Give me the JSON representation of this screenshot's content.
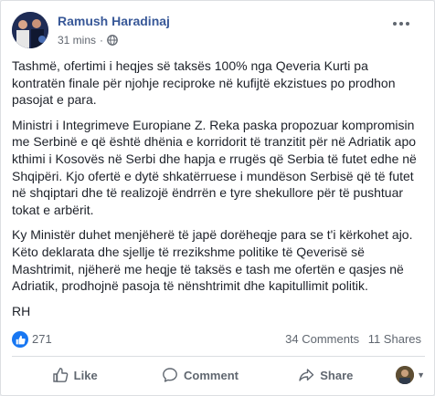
{
  "post": {
    "author": "Ramush Haradinaj",
    "time": "31 mins",
    "separator": "·",
    "paragraphs": [
      "Tashmë, ofertimi i heqjes së taksës 100% nga Qeveria Kurti pa kontratën finale për njohje reciproke në kufijtë ekzistues po prodhon pasojat e para.",
      "Ministri i Integrimeve Europiane Z. Reka paska propozuar kompromisin me Serbinë e që është dhënia e korridorit të tranzitit për në Adriatik apo kthimi i Kosovës në Serbi dhe hapja e rrugës që Serbia të futet edhe në Shqipëri. Kjo ofertë e dytë shkatërruese i mundëson Serbisë që të futet në shqiptari dhe të realizojë ëndrrën e tyre shekullore për të pushtuar tokat e arbërit.",
      "Ky Ministër duhet menjëherë të japë dorëheqje para se t'i kërkohet ajo. Këto deklarata dhe sjellje të rrezikshme politike të Qeverisë së Mashtrimit, njëherë me heqje të taksës e tash me ofertën e qasjes në Adriatik, prodhojnë pasoja të nënshtrimit dhe kapitullimit politik.",
      "RH"
    ]
  },
  "stats": {
    "likes": "271",
    "comments": "34 Comments",
    "shares": "11 Shares"
  },
  "actions": {
    "like": "Like",
    "comment": "Comment",
    "share": "Share"
  },
  "colors": {
    "brand_blue": "#385898",
    "like_blue": "#1877f2",
    "muted_text": "#606770"
  },
  "icons": {
    "privacy": "globe-icon",
    "options": "more-options-icon"
  }
}
